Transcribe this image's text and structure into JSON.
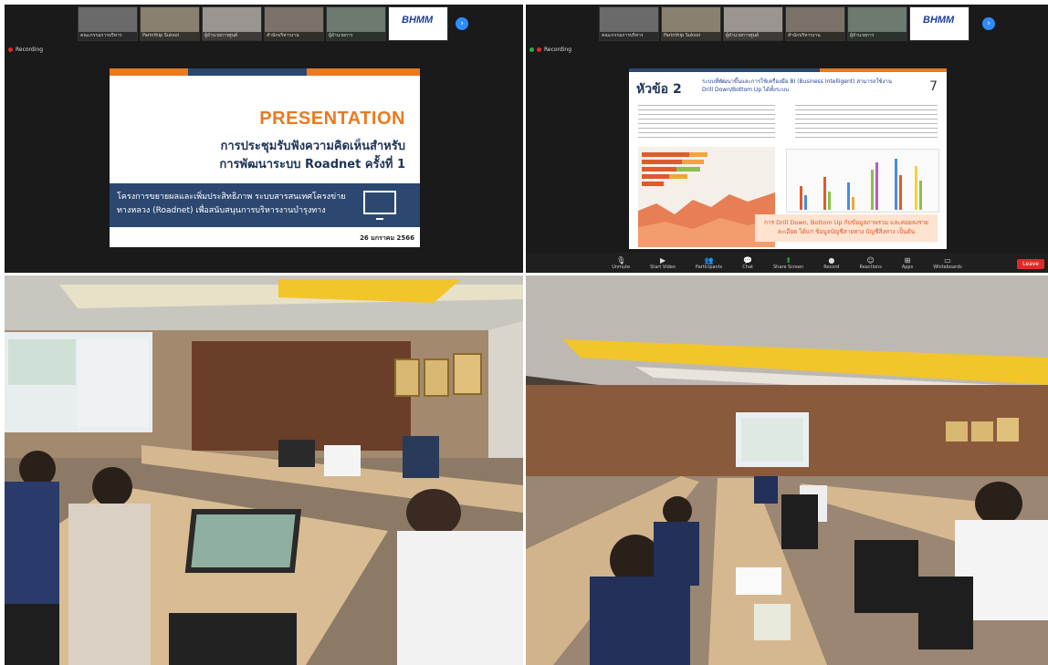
{
  "q1": {
    "thumbnails": [
      {
        "label": "คณะกรรมการบริหาร"
      },
      {
        "label": "Parinthip Suksoi"
      },
      {
        "label": "ผู้อำนวยการศูนย์"
      },
      {
        "label": "สำนักบริหารงาน"
      },
      {
        "label": "ผู้อำนวยการ"
      },
      {
        "brand": "BHMM"
      }
    ],
    "recording": "Recording",
    "slide": {
      "title": "PRESENTATION",
      "subtitle_line1": "การประชุมรับฟังความคิดเห็นสำหรับ",
      "subtitle_line2": "การพัฒนาระบบ Roadnet ครั้งที่ 1",
      "band_text": "โครงการขยายผลและเพิ่มประสิทธิภาพ ระบบสารสนเทศโครงข่ายทางหลวง (Roadnet) เพื่อสนับสนุนการบริหารงานบำรุงทาง",
      "date": "26 มกราคม 2566"
    }
  },
  "q2": {
    "thumbnails": [
      {
        "label": "คณะกรรมการบริหาร"
      },
      {
        "label": "Parinthip Suksoi"
      },
      {
        "label": "ผู้อำนวยการศูนย์"
      },
      {
        "label": "สำนักบริหารงาน"
      },
      {
        "label": "ผู้อำนวยการ"
      },
      {
        "brand": "BHMM"
      }
    ],
    "recording": "Recording",
    "slide": {
      "heading": "หัวข้อ 2",
      "heading_text": "ระบบที่พัฒนาขึ้นและการใช้เครื่องมือ BI (Business Intelligent) สามารถใช้งาน Drill Down/Bottom Up ได้ทั้งระบบ",
      "page_number": "7",
      "note": "การ Drill Down, Bottom Up กับข้อมูลภาพรวม และค่อยลงรายละเอียด ได้แก่ ข้อมูลบัญชีสายทาง บัญชีสิ่งทาง เป็นต้น"
    },
    "toolbar": [
      {
        "label": "Unmute",
        "icon": "mic-icon"
      },
      {
        "label": "Start Video",
        "icon": "video-icon"
      },
      {
        "label": "Participants",
        "icon": "participants-icon"
      },
      {
        "label": "Chat",
        "icon": "chat-icon"
      },
      {
        "label": "Share Screen",
        "icon": "share-icon"
      },
      {
        "label": "Record",
        "icon": "record-icon"
      },
      {
        "label": "Reactions",
        "icon": "reactions-icon"
      },
      {
        "label": "Apps",
        "icon": "apps-icon"
      },
      {
        "label": "Whiteboards",
        "icon": "whiteboard-icon"
      }
    ],
    "leave": "Leave"
  },
  "colors": {
    "accent_orange": "#e97a20",
    "navy": "#2c4870",
    "zoom_blue": "#2d8cff"
  }
}
